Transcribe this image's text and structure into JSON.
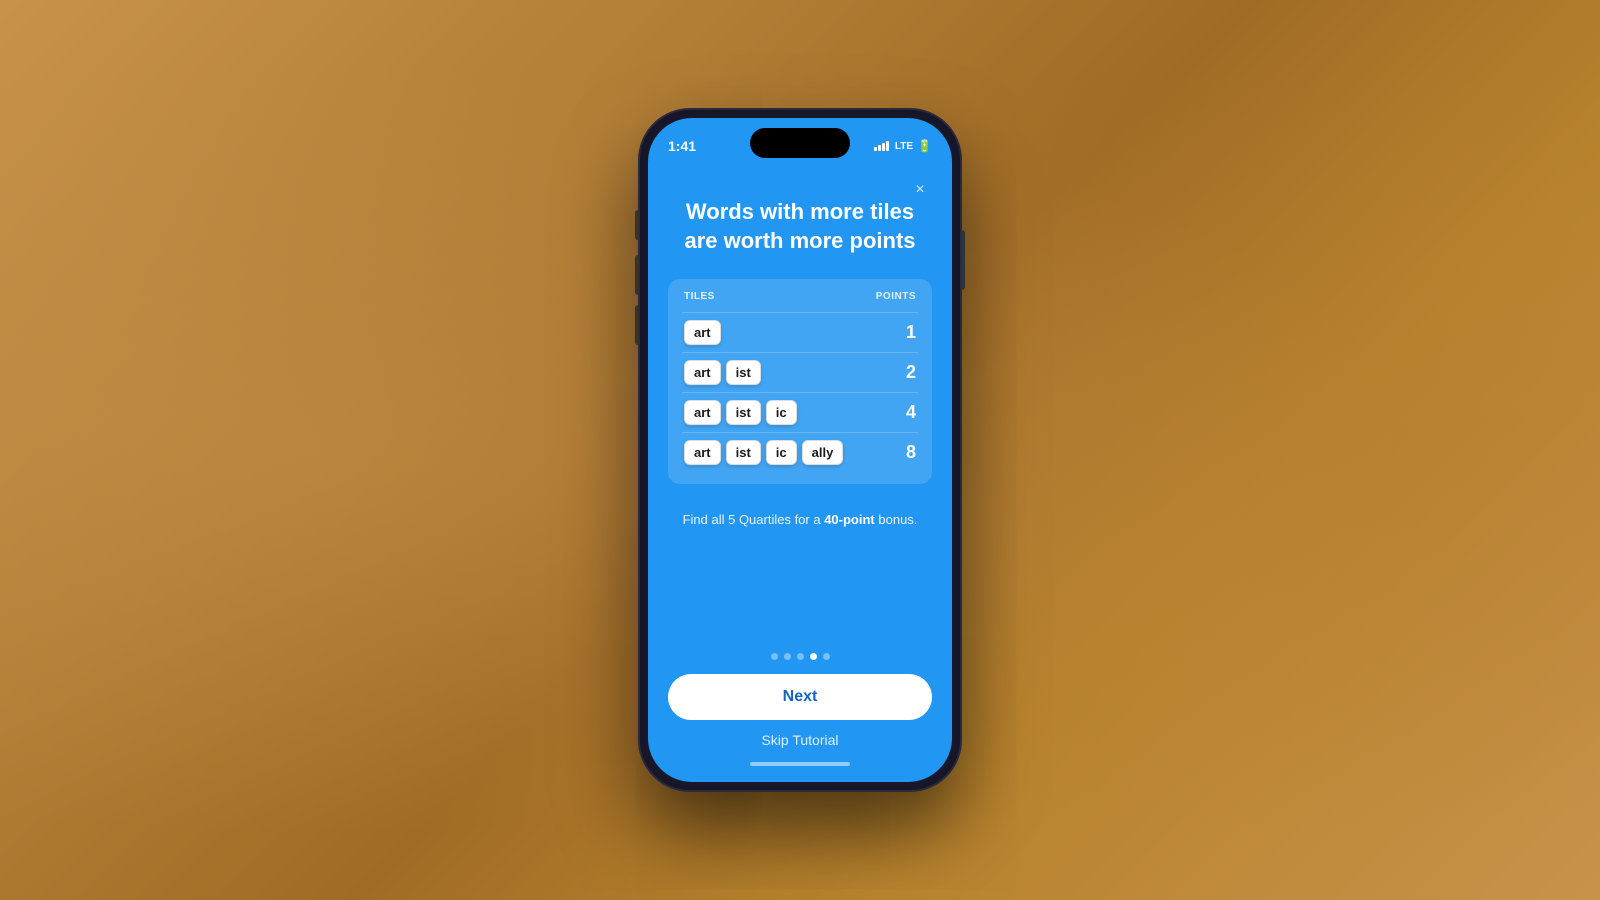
{
  "background": {
    "color": "#b07d35"
  },
  "phone": {
    "status_bar": {
      "time": "1:41",
      "signal_label": "signal",
      "lte_label": "LTE",
      "battery_label": "battery"
    },
    "close_button_label": "×",
    "title": "Words with more tiles are worth more points",
    "table": {
      "header_tiles": "TILES",
      "header_points": "POINTS",
      "rows": [
        {
          "tiles": [
            "art"
          ],
          "points": "1"
        },
        {
          "tiles": [
            "art",
            "ist"
          ],
          "points": "2"
        },
        {
          "tiles": [
            "art",
            "ist",
            "ic"
          ],
          "points": "4"
        },
        {
          "tiles": [
            "art",
            "ist",
            "ic",
            "ally"
          ],
          "points": "8"
        }
      ]
    },
    "bonus_text_prefix": "Find all 5 Quartiles for a ",
    "bonus_highlight": "40-point",
    "bonus_text_suffix": " bonus.",
    "dots": [
      {
        "active": false
      },
      {
        "active": false
      },
      {
        "active": false
      },
      {
        "active": true
      },
      {
        "active": false
      }
    ],
    "next_button_label": "Next",
    "skip_button_label": "Skip Tutorial"
  }
}
